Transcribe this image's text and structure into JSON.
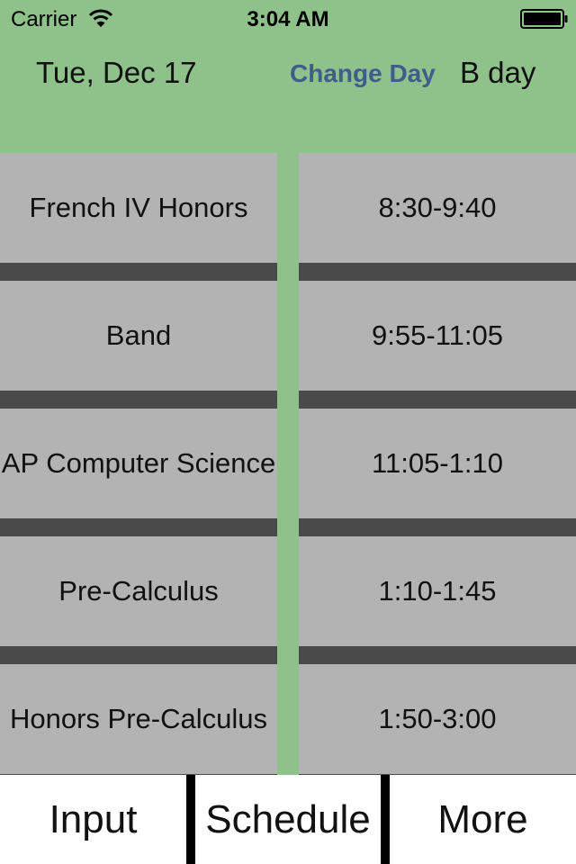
{
  "status_bar": {
    "carrier": "Carrier",
    "time": "3:04 AM"
  },
  "header": {
    "date": "Tue, Dec 17",
    "change_day_label": "Change Day",
    "day_label": "B day"
  },
  "schedule": {
    "classes": [
      "French IV Honors",
      "Band",
      "AP Computer Science",
      "Pre-Calculus",
      "Honors Pre-Calculus"
    ],
    "times": [
      "8:30-9:40",
      "9:55-11:05",
      "11:05-1:10",
      "1:10-1:45",
      "1:50-3:00"
    ]
  },
  "tabs": {
    "input": "Input",
    "schedule": "Schedule",
    "more": "More"
  },
  "colors": {
    "background": "#8fc18b",
    "cell": "#b3b3b3",
    "separator": "#4a4a4a",
    "link": "#3e5c8c"
  },
  "icons": {
    "wifi": "wifi-icon",
    "battery": "battery-icon"
  }
}
